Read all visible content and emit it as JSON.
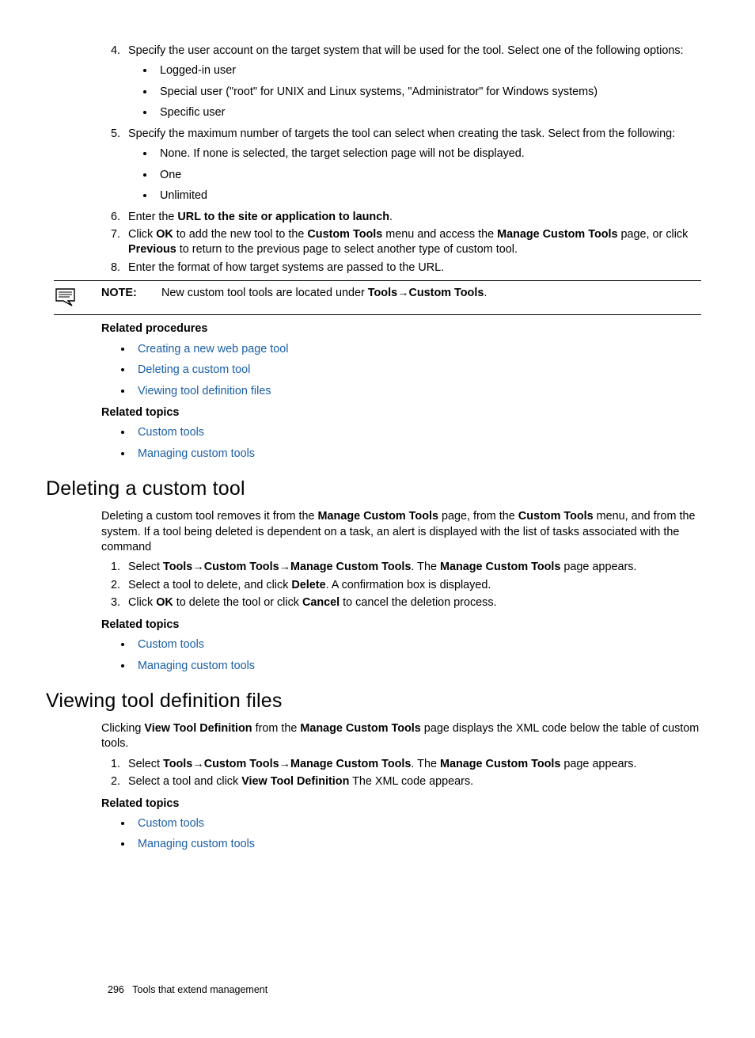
{
  "top": {
    "items4to8": [
      {
        "num": "4",
        "text": "Specify the user account on the target system that will be used for the tool. Select one of the following options:",
        "sub": [
          "Logged-in user",
          "Special user (\"root\" for UNIX and Linux systems, \"Administrator\" for Windows systems)",
          "Specific user"
        ]
      },
      {
        "num": "5",
        "text": "Specify the maximum number of targets the tool can select when creating the task. Select from the following:",
        "sub": [
          "None. If none is selected, the target selection page will not be displayed.",
          "One",
          "Unlimited"
        ]
      },
      {
        "num": "6",
        "pre": "Enter the ",
        "bold": "URL to the site or application to launch",
        "post": "."
      },
      {
        "num": "7",
        "segments": [
          {
            "t": "Click "
          },
          {
            "t": "OK",
            "b": true
          },
          {
            "t": " to add the new tool to the "
          },
          {
            "t": "Custom Tools",
            "b": true
          },
          {
            "t": " menu and access the "
          },
          {
            "t": "Manage Custom Tools",
            "b": true
          },
          {
            "t": " page, or click "
          },
          {
            "t": "Previous",
            "b": true
          },
          {
            "t": " to return to the previous page to select another type of custom tool."
          }
        ]
      },
      {
        "num": "8",
        "text": "Enter the format of how target systems are passed to the URL."
      }
    ]
  },
  "note": {
    "label": "NOTE:",
    "segments": [
      {
        "t": "New custom tool tools are located under "
      },
      {
        "t": "Tools",
        "b": true
      },
      {
        "t": "→",
        "arrow": true
      },
      {
        "t": "Custom Tools",
        "b": true
      },
      {
        "t": "."
      }
    ]
  },
  "related_proc": {
    "heading": "Related procedures",
    "items": [
      "Creating a new web page tool",
      "Deleting a custom tool",
      "Viewing tool definition files"
    ]
  },
  "related_topics1": {
    "heading": "Related topics",
    "items": [
      "Custom tools",
      "Managing custom tools"
    ]
  },
  "sec_deleting": {
    "title": "Deleting a custom tool",
    "para_segments": [
      {
        "t": "Deleting a custom tool removes it from the "
      },
      {
        "t": "Manage Custom Tools",
        "b": true
      },
      {
        "t": " page, from the "
      },
      {
        "t": "Custom Tools",
        "b": true
      },
      {
        "t": " menu, and from the system. If a tool being deleted is dependent on a task, an alert is displayed with the list of tasks associated with the command"
      }
    ],
    "steps": [
      {
        "segments": [
          {
            "t": "Select "
          },
          {
            "t": "Tools",
            "b": true
          },
          {
            "t": "→",
            "arrow": true
          },
          {
            "t": "Custom Tools",
            "b": true
          },
          {
            "t": "→",
            "arrow": true
          },
          {
            "t": "Manage Custom Tools",
            "b": true
          },
          {
            "t": ". The "
          },
          {
            "t": "Manage Custom Tools",
            "b": true
          },
          {
            "t": " page appears."
          }
        ]
      },
      {
        "segments": [
          {
            "t": "Select a tool to delete, and click "
          },
          {
            "t": "Delete",
            "b": true
          },
          {
            "t": ". A confirmation box is displayed."
          }
        ]
      },
      {
        "segments": [
          {
            "t": "Click "
          },
          {
            "t": "OK",
            "b": true
          },
          {
            "t": " to delete the tool or click "
          },
          {
            "t": "Cancel",
            "b": true
          },
          {
            "t": " to cancel the deletion process."
          }
        ]
      }
    ]
  },
  "related_topics2": {
    "heading": "Related topics",
    "items": [
      "Custom tools",
      "Managing custom tools"
    ]
  },
  "sec_viewing": {
    "title": "Viewing tool definition files",
    "para_segments": [
      {
        "t": "Clicking "
      },
      {
        "t": "View Tool Definition",
        "b": true
      },
      {
        "t": " from the "
      },
      {
        "t": "Manage Custom Tools",
        "b": true
      },
      {
        "t": " page displays the XML code below the table of custom tools."
      }
    ],
    "steps": [
      {
        "segments": [
          {
            "t": "Select "
          },
          {
            "t": "Tools",
            "b": true
          },
          {
            "t": "→",
            "arrow": true
          },
          {
            "t": "Custom Tools",
            "b": true
          },
          {
            "t": "→",
            "arrow": true
          },
          {
            "t": "Manage Custom Tools",
            "b": true
          },
          {
            "t": ". The "
          },
          {
            "t": "Manage Custom Tools",
            "b": true
          },
          {
            "t": " page appears."
          }
        ]
      },
      {
        "segments": [
          {
            "t": "Select a tool and click "
          },
          {
            "t": "View Tool Definition",
            "b": true
          },
          {
            "t": " The XML code appears."
          }
        ]
      }
    ]
  },
  "related_topics3": {
    "heading": "Related topics",
    "items": [
      "Custom tools",
      "Managing custom tools"
    ]
  },
  "footer": {
    "page": "296",
    "title": "Tools that extend management"
  }
}
